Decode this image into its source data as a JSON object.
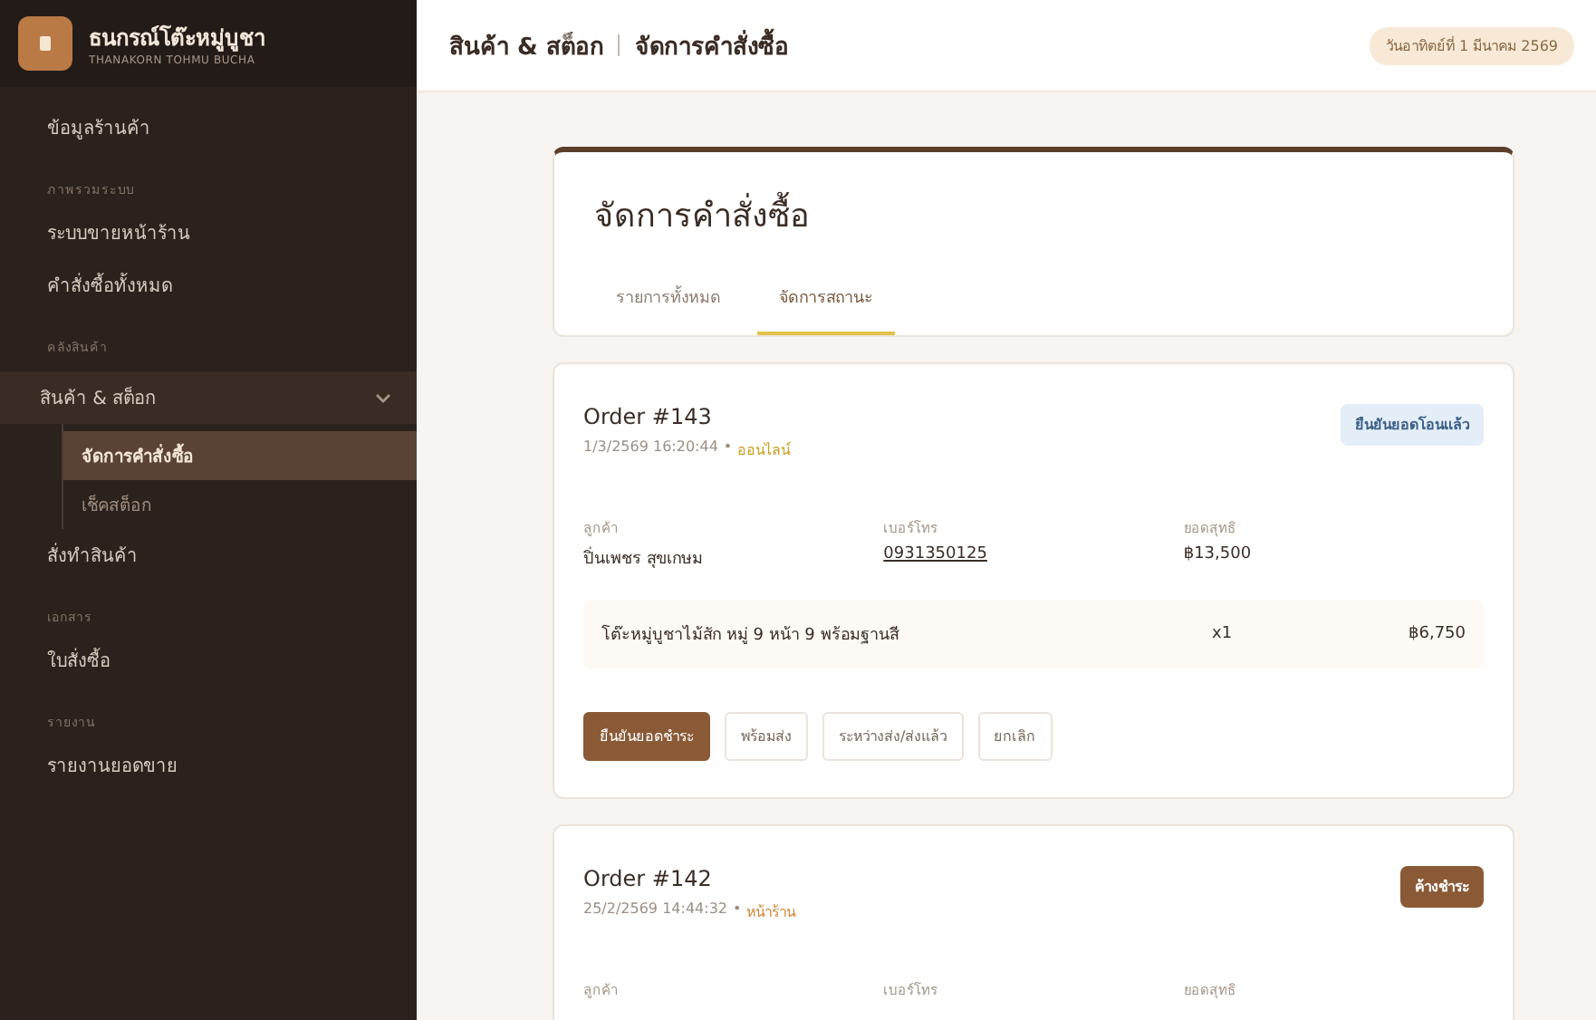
{
  "brand": {
    "name": "ธนกรณ์โต๊ะหมู่บูชา",
    "subtitle": "THANAKORN TOHMU BUCHA"
  },
  "sidebar": {
    "items": [
      {
        "kind": "item",
        "label": "ข้อมูลร้านค้า",
        "selected": false
      },
      {
        "kind": "section",
        "label": "ภาพรวมระบบ"
      },
      {
        "kind": "item",
        "label": "ระบบขายหน้าร้าน",
        "selected": false
      },
      {
        "kind": "item",
        "label": "คำสั่งซื้อทั้งหมด",
        "selected": false
      },
      {
        "kind": "section",
        "label": "คลังสินค้า"
      },
      {
        "kind": "group",
        "label": "สินค้า & สต็อก",
        "expanded": true,
        "children": [
          {
            "label": "จัดการคำสั่งซื้อ",
            "selected": true
          },
          {
            "label": "เช็คสต็อก",
            "selected": false
          }
        ]
      },
      {
        "kind": "item",
        "label": "สั่งทำสินค้า",
        "selected": false
      },
      {
        "kind": "section",
        "label": "เอกสาร"
      },
      {
        "kind": "item",
        "label": "ใบสั่งซื้อ",
        "selected": false
      },
      {
        "kind": "section",
        "label": "รายงาน"
      },
      {
        "kind": "item",
        "label": "รายงานยอดขาย",
        "selected": false
      }
    ]
  },
  "header": {
    "breadcrumb": [
      "สินค้า & สต็อก",
      "จัดการคำสั่งซื้อ"
    ],
    "date": "วันอาทิตย์ที่ 1 มีนาคม 2569"
  },
  "page": {
    "title": "จัดการคำสั่งซื้อ",
    "tabs": [
      {
        "label": "รายการทั้งหมด",
        "selected": false
      },
      {
        "label": "จัดการสถานะ",
        "selected": true
      }
    ]
  },
  "orders": [
    {
      "title": "Order #143",
      "datetime": "1/3/2569 16:20:44",
      "separator": "•",
      "channel": {
        "label": "ออนไลน์",
        "color": "#c9a227"
      },
      "status": {
        "label": "ยืนยันยอดโอนแล้ว",
        "color": "#e3eef9"
      },
      "fields": [
        {
          "label": "ลูกค้า",
          "value": "ปิ่นเพชร สุขเกษม"
        },
        {
          "label": "เบอร์โทร",
          "value": "0931350125",
          "kind": "link"
        },
        {
          "label": "ยอดสุทธิ",
          "value": "฿13,500"
        }
      ],
      "items": [
        {
          "name": "โต๊ะหมู่บูชาไม้สัก หมู่ 9 หน้า 9 พร้อมฐานสี",
          "qty": "x1",
          "price": "฿6,750"
        }
      ],
      "actions": [
        {
          "label": "ยืนยันยอดชำระ",
          "kind": "primary"
        },
        {
          "label": "พร้อมส่ง",
          "kind": "secondary"
        },
        {
          "label": "ระหว่างส่ง/ส่งแล้ว",
          "kind": "secondary"
        },
        {
          "label": "ยกเลิก",
          "kind": "secondary"
        }
      ]
    },
    {
      "title": "Order #142",
      "datetime": "25/2/2569 14:44:32",
      "separator": "•",
      "channel": {
        "label": "หน้าร้าน",
        "color": "#d08a3c"
      },
      "status": {
        "label": "ค้างชำระ",
        "color": "#8a5a36"
      },
      "fields": [
        {
          "label": "ลูกค้า"
        },
        {
          "label": "เบอร์โทร"
        },
        {
          "label": "ยอดสุทธิ"
        }
      ]
    }
  ]
}
